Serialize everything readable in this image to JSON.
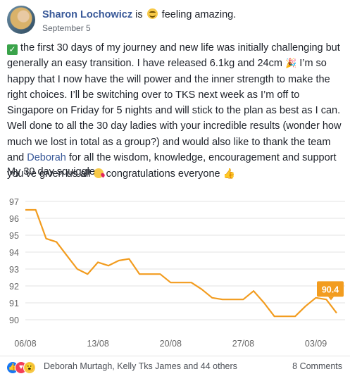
{
  "post": {
    "author": "Sharon Lochowicz",
    "is_text": "is",
    "feeling_text": "feeling amazing.",
    "date": "September 5",
    "body_part1": "the first 30 days of my journey and new life was initially challenging but generally an easy transition. I have released 6.1kg and 24cm",
    "body_part2": "I’m so happy that I now have the will power and the inner strength to make the right choices. I’ll be switching over to TKS next week as I’m off to Singapore on Friday for 5 nights and will stick to the plan as best as I can. Well done to all the 30 day ladies with your incredible results (wonder how much we lost in total as a group?) and would also like to thank the team and",
    "mention": "Deborah",
    "body_part3": "for all the wisdom, knowledge, encouragement and support you’ve given us all",
    "body_part4": "congratulations everyone",
    "caption": "My 30 day squiggle"
  },
  "icons": {
    "feeling": "smiling-face-icon",
    "check": "check-mark-icon",
    "party": "party-popper-icon",
    "kiss": "kissing-face-icon",
    "thumb": "thumbs-up-icon"
  },
  "colors": {
    "author": "#385898",
    "line": "#f29c1f",
    "label_bg": "#f29c1f",
    "grid": "#e3e3e3",
    "axis_text": "#666666"
  },
  "chart_data": {
    "type": "line",
    "ylim": [
      90,
      97
    ],
    "yticks": [
      "97",
      "96",
      "95",
      "94",
      "93",
      "92",
      "91",
      "90"
    ],
    "xticks": [
      "06/08",
      "13/08",
      "20/08",
      "27/08",
      "03/09"
    ],
    "x": [
      "06/08",
      "07/08",
      "08/08",
      "09/08",
      "10/08",
      "11/08",
      "12/08",
      "13/08",
      "14/08",
      "15/08",
      "16/08",
      "17/08",
      "18/08",
      "19/08",
      "20/08",
      "21/08",
      "22/08",
      "23/08",
      "24/08",
      "25/08",
      "26/08",
      "27/08",
      "28/08",
      "29/08",
      "30/08",
      "31/08",
      "01/09",
      "02/09",
      "03/09",
      "04/09",
      "05/09"
    ],
    "values": [
      96.5,
      96.5,
      94.8,
      94.6,
      93.8,
      93.0,
      92.7,
      93.4,
      93.2,
      93.5,
      93.6,
      92.7,
      92.7,
      92.7,
      92.2,
      92.2,
      92.2,
      91.8,
      91.3,
      91.2,
      91.2,
      91.2,
      91.7,
      91.0,
      90.2,
      90.2,
      90.2,
      90.8,
      91.3,
      91.2,
      90.4
    ],
    "end_label": "90.4"
  },
  "reactions": {
    "icons": [
      "like-reaction-icon",
      "love-reaction-icon",
      "wow-reaction-icon"
    ],
    "names": "Deborah Murtagh, Kelly Tks James and 44 others",
    "comments": "8 Comments"
  }
}
